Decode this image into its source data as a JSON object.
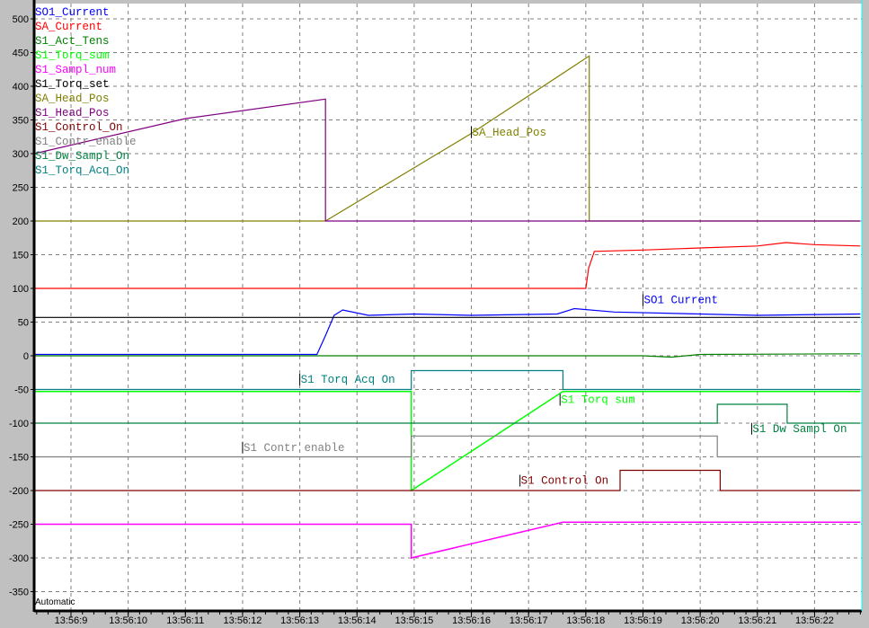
{
  "chart_data": {
    "type": "line",
    "title": "",
    "xlabel": "",
    "ylabel": "",
    "xlim": [
      8.36,
      22.8
    ],
    "ylim": [
      -373,
      523
    ],
    "grid": true,
    "legend_position": "top-left",
    "status_text": "Automatic",
    "x_ticks": [
      {
        "t": 9,
        "label": "13:56:9"
      },
      {
        "t": 10,
        "label": "13:56:10"
      },
      {
        "t": 11,
        "label": "13:56:11"
      },
      {
        "t": 12,
        "label": "13:56:12"
      },
      {
        "t": 13,
        "label": "13:56:13"
      },
      {
        "t": 14,
        "label": "13:56:14"
      },
      {
        "t": 15,
        "label": "13:56:15"
      },
      {
        "t": 16,
        "label": "13:56:16"
      },
      {
        "t": 17,
        "label": "13:56:17"
      },
      {
        "t": 18,
        "label": "13:56:18"
      },
      {
        "t": 19,
        "label": "13:56:19"
      },
      {
        "t": 20,
        "label": "13:56:20"
      },
      {
        "t": 21,
        "label": "13:56:21"
      },
      {
        "t": 22,
        "label": "13:56:22"
      }
    ],
    "y_ticks": [
      -350,
      -300,
      -250,
      -200,
      -150,
      -100,
      -50,
      0,
      50,
      100,
      150,
      200,
      250,
      300,
      350,
      400,
      450,
      500
    ],
    "series": [
      {
        "name": "SO1_Current",
        "color": "#0000ff",
        "points": [
          [
            8.36,
            2
          ],
          [
            13.3,
            2
          ],
          [
            13.45,
            30
          ],
          [
            13.6,
            60
          ],
          [
            13.75,
            68
          ],
          [
            14.2,
            60
          ],
          [
            15,
            62
          ],
          [
            16,
            60
          ],
          [
            17.5,
            62
          ],
          [
            17.8,
            70
          ],
          [
            18.5,
            65
          ],
          [
            20,
            62
          ],
          [
            21,
            60
          ],
          [
            22.8,
            62
          ]
        ]
      },
      {
        "name": "SA_Current",
        "color": "#ff0000",
        "points": [
          [
            8.36,
            100
          ],
          [
            18.0,
            100
          ],
          [
            18.05,
            130
          ],
          [
            18.15,
            155
          ],
          [
            19,
            157
          ],
          [
            20,
            160
          ],
          [
            21,
            163
          ],
          [
            21.5,
            168
          ],
          [
            22,
            165
          ],
          [
            22.8,
            163
          ]
        ]
      },
      {
        "name": "S1_Act_Tens",
        "color": "#008000",
        "points": [
          [
            8.36,
            0
          ],
          [
            19.0,
            0
          ],
          [
            19.5,
            -2
          ],
          [
            20,
            2
          ],
          [
            22.8,
            3
          ]
        ]
      },
      {
        "name": "S1_Torq_sum",
        "color": "#00ff00",
        "points": [
          [
            8.36,
            -53
          ],
          [
            14.95,
            -53
          ],
          [
            14.95,
            -200
          ],
          [
            17.6,
            -53
          ],
          [
            22.8,
            -53
          ]
        ]
      },
      {
        "name": "S1_Sampl_num",
        "color": "#ff00ff",
        "points": [
          [
            8.36,
            -250
          ],
          [
            14.95,
            -250
          ],
          [
            14.95,
            -300
          ],
          [
            17.6,
            -247
          ],
          [
            22.8,
            -247
          ]
        ]
      },
      {
        "name": "S1_Torq_set",
        "color": "#000000",
        "points": [
          [
            8.36,
            57
          ],
          [
            22.8,
            57
          ]
        ]
      },
      {
        "name": "SA_Head_Pos",
        "color": "#808000",
        "points": [
          [
            8.36,
            200
          ],
          [
            13.45,
            200
          ],
          [
            16,
            330
          ],
          [
            18.06,
            445
          ],
          [
            18.06,
            200
          ],
          [
            22.8,
            200
          ]
        ]
      },
      {
        "name": "S1_Head_Pos",
        "color": "#800080",
        "points": [
          [
            8.36,
            300
          ],
          [
            11,
            352
          ],
          [
            13.45,
            381
          ],
          [
            13.45,
            200
          ],
          [
            22.8,
            200
          ]
        ]
      },
      {
        "name": "S1_Control_On",
        "color": "#800000",
        "points": [
          [
            8.36,
            -200
          ],
          [
            18.6,
            -200
          ],
          [
            18.6,
            -170
          ],
          [
            20.35,
            -170
          ],
          [
            20.35,
            -200
          ],
          [
            22.8,
            -200
          ]
        ]
      },
      {
        "name": "S1_Contr_enable",
        "color": "#808080",
        "points": [
          [
            8.36,
            -150
          ],
          [
            14.95,
            -150
          ],
          [
            14.95,
            -119
          ],
          [
            20.3,
            -119
          ],
          [
            20.3,
            -150
          ],
          [
            22.8,
            -150
          ]
        ]
      },
      {
        "name": "S1_Dw_Sampl_On",
        "color": "#008040",
        "points": [
          [
            8.36,
            -100
          ],
          [
            20.3,
            -100
          ],
          [
            20.3,
            -72
          ],
          [
            21.52,
            -72
          ],
          [
            21.52,
            -100
          ],
          [
            22.8,
            -100
          ]
        ]
      },
      {
        "name": "S1_Torq_Acq_On",
        "color": "#008080",
        "points": [
          [
            8.36,
            -50
          ],
          [
            14.95,
            -50
          ],
          [
            14.95,
            -22
          ],
          [
            17.6,
            -22
          ],
          [
            17.6,
            -50
          ],
          [
            22.8,
            -50
          ]
        ]
      }
    ],
    "annotations": [
      {
        "text": "SA_Head_Pos",
        "t": 16.0,
        "v": 327,
        "color": "#808000"
      },
      {
        "text": "SO1 Current",
        "t": 19.0,
        "v": 78,
        "color": "#0000ff"
      },
      {
        "text": "S1 Torq Acq On",
        "t": 13.0,
        "v": -40,
        "color": "#008080"
      },
      {
        "text": "S1 Torq sum",
        "t": 17.55,
        "v": -70,
        "color": "#00ff00"
      },
      {
        "text": "S1 Contr enable",
        "t": 12.0,
        "v": -141,
        "color": "#808080"
      },
      {
        "text": "S1 Dw Sampl On",
        "t": 20.9,
        "v": -113,
        "color": "#008040"
      },
      {
        "text": "S1 Control On",
        "t": 16.85,
        "v": -190,
        "color": "#800000"
      }
    ]
  }
}
